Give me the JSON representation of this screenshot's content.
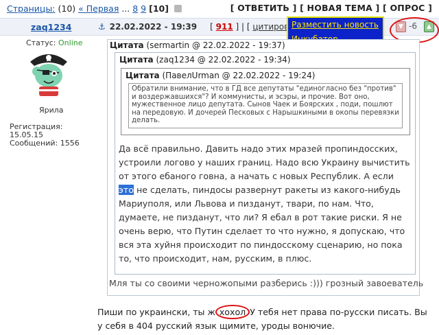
{
  "pagination": {
    "label": "Страницы:",
    "count": "(10)",
    "first": "« Первая",
    "ellipsis": "...",
    "page8": "8",
    "page9": "9",
    "current": "[10]"
  },
  "actions": {
    "reply": "ОТВЕТИТЬ",
    "new_topic": "НОВАЯ ТЕМА",
    "poll": "ОПРОС"
  },
  "dropdown": {
    "items": [
      "Разместить новость",
      "Инкубатор"
    ]
  },
  "post": {
    "author": "zaq1234",
    "date": "22.02.2022 - 19:39",
    "number": "911",
    "quote_link": "цитировать",
    "rating": "-6",
    "status_label": "Статус:",
    "status_value": "Online",
    "avatar_name": "Ярила",
    "registration": "Регистрация: 15.05.15",
    "messages": "Сообщений: 1556",
    "quote1": {
      "label": "Цитата",
      "meta": "(sermartin @ 22.02.2022 - 19:37)",
      "text": "Мля ты со своими черножопыми разберись :))) грозный завоеватель"
    },
    "quote2": {
      "label": "Цитата",
      "meta": "(zaq1234 @ 22.02.2022 - 19:34)",
      "text_before": "Да всё правильно. Давить надо этих мразей пропиндосских, устроили логово у наших границ. Надо всю Украину вычистить от этого ебаного говна, а начать с новых Республик. А если ",
      "text_highlight": "это",
      "text_after": " не сделать, пиндосы развернут ракеты из какого-нибудь Мариуполя, или Львова и пизданут, твари, по нам. Что, думаете, не пизданут, что ли? Я ебал в рот такие риски. Я не очень верю, что Путин сделает то что нужно, я допускаю, что вся эта хуйня происходит по пиндосскому сценарию, но пока то, что происходит, нам, русским, в плюс."
    },
    "quote3": {
      "label": "Цитата",
      "meta": "(ПавелUrman @ 22.02.2022 - 19:24)",
      "text": "Обратили внимание, что в ГД все депутаты \"единогласно без \"против\" и воздержавшихся\"? И коммунисты, и эсэры, и прочие. Вот оно, мужественное лицо депутата. Сынов Чаек и Боярских , поди, пошлют на передовую. И дочерей Песковых с Нарышкиными в окопы перевязки делать."
    },
    "reply_before": "Пиши по украински, ты ж ",
    "reply_circled": "хохол",
    "reply_after": " У тебя нет права по-русски писать. Вы у себя в 404 русский язык щимите, уроды вонючие."
  }
}
